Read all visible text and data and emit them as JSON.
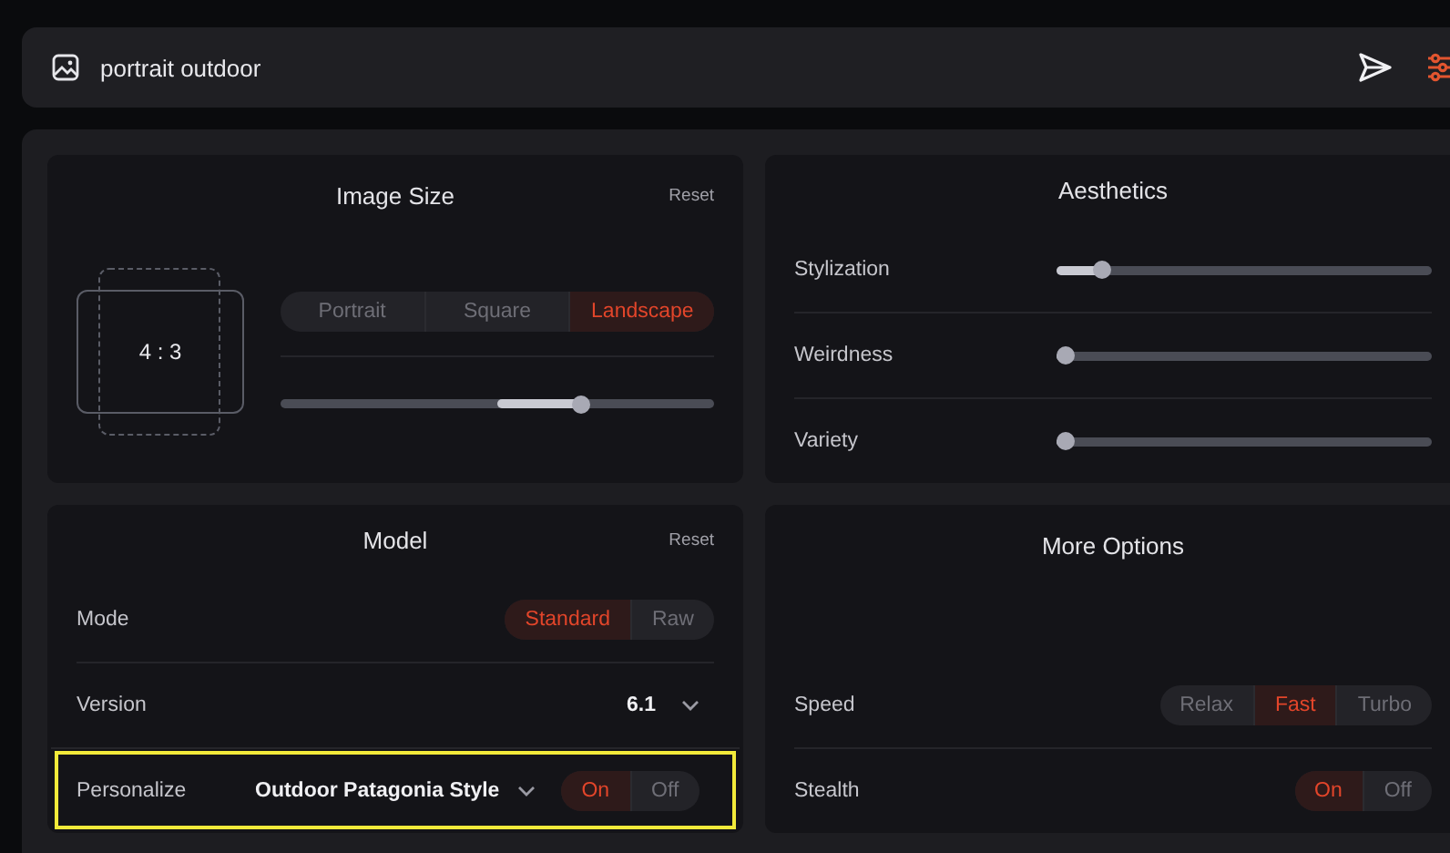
{
  "prompt": {
    "value": "portrait outdoor"
  },
  "image_size": {
    "title": "Image Size",
    "reset": "Reset",
    "ratio": "4 : 3",
    "options": [
      {
        "label": "Portrait",
        "selected": false
      },
      {
        "label": "Square",
        "selected": false
      },
      {
        "label": "Landscape",
        "selected": true
      }
    ],
    "level": 0.7
  },
  "aesthetics": {
    "title": "Aesthetics",
    "rows": [
      {
        "kind": "slider",
        "label": "Stylization",
        "level": 0.1
      },
      {
        "kind": "slider",
        "label": "Weirdness",
        "level": 0.0
      },
      {
        "kind": "slider",
        "label": "Variety",
        "level": 0.0
      }
    ]
  },
  "model": {
    "title": "Model",
    "reset": "Reset",
    "rows": [
      {
        "kind": "segmented",
        "label": "Mode",
        "options": [
          {
            "label": "Standard",
            "selected": true
          },
          {
            "label": "Raw",
            "selected": false
          }
        ]
      },
      {
        "kind": "dropdown",
        "label": "Version",
        "value": "6.1"
      },
      {
        "kind": "personalize",
        "label": "Personalize",
        "value": "Outdoor Patagonia Style",
        "highlighted": true,
        "options": [
          {
            "label": "On",
            "selected": true
          },
          {
            "label": "Off",
            "selected": false
          }
        ]
      }
    ]
  },
  "more_options": {
    "title": "More Options",
    "rows": [
      {
        "kind": "segmented",
        "label": "Speed",
        "options": [
          {
            "label": "Relax",
            "selected": false
          },
          {
            "label": "Fast",
            "selected": true
          },
          {
            "label": "Turbo",
            "selected": false
          }
        ]
      },
      {
        "kind": "segmented",
        "label": "Stealth",
        "options": [
          {
            "label": "On",
            "selected": true
          },
          {
            "label": "Off",
            "selected": false
          }
        ]
      }
    ]
  }
}
